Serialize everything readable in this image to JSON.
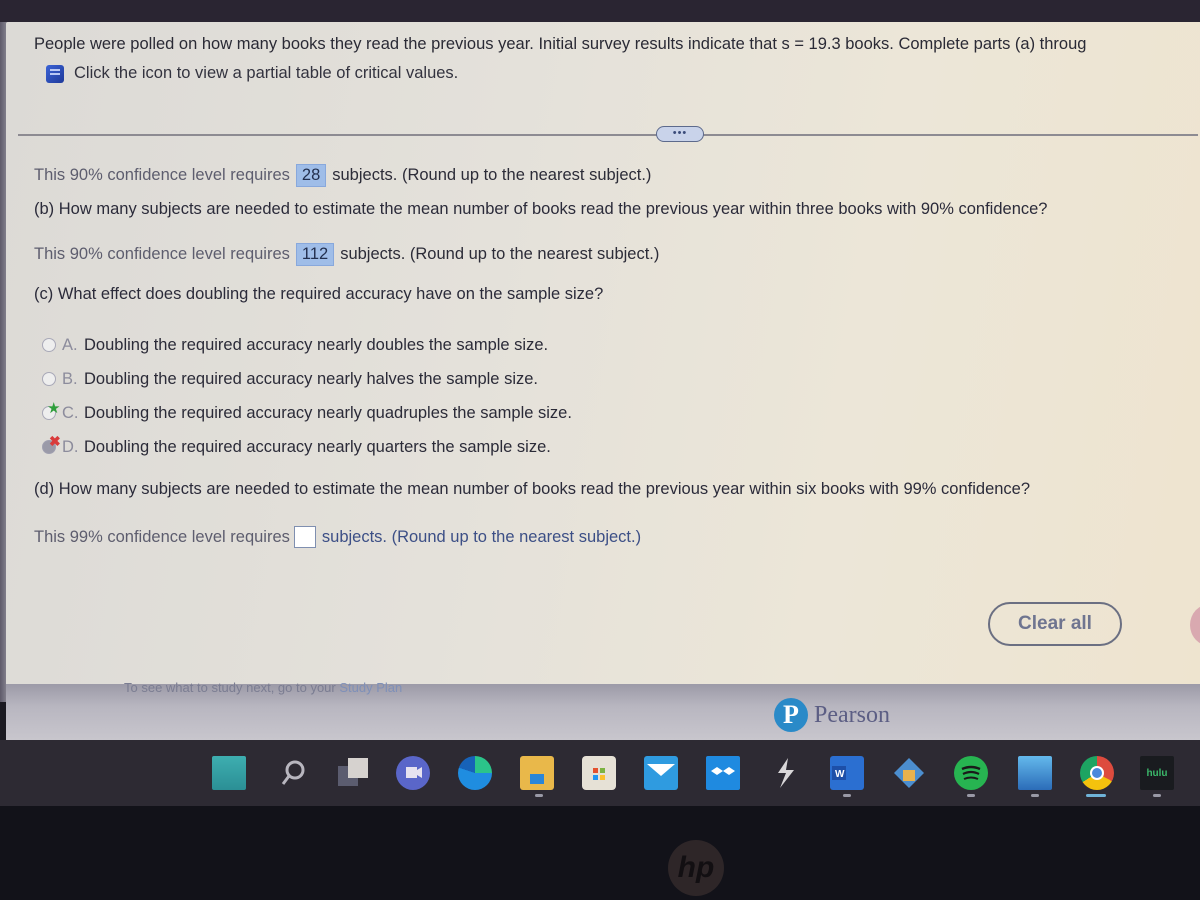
{
  "question": {
    "header_text": "People were polled on how many books they read the previous year. Initial survey results indicate that s = 19.3 books. Complete parts (a) throug",
    "table_link_text": "Click the icon to view a partial table of critical values.",
    "more_button_label": "•••"
  },
  "part_a": {
    "result_prefix": "This 90% confidence level requires",
    "answer": "28",
    "result_suffix": "subjects. (Round up to the nearest subject.)"
  },
  "part_b": {
    "question": "(b) How many subjects are needed to estimate the mean number of books read the previous year within three books with 90% confidence?",
    "result_prefix": "This 90% confidence level requires",
    "answer": "112",
    "result_suffix": "subjects. (Round up to the nearest subject.)"
  },
  "part_c": {
    "question": "(c) What effect does doubling the required accuracy have on the sample size?",
    "options": [
      {
        "letter": "A.",
        "text": "Doubling the required accuracy nearly doubles the sample size.",
        "state": "unselected"
      },
      {
        "letter": "B.",
        "text": "Doubling the required accuracy nearly halves the sample size.",
        "state": "unselected"
      },
      {
        "letter": "C.",
        "text": "Doubling the required accuracy nearly quadruples the sample size.",
        "state": "correct-answer",
        "mark": "★"
      },
      {
        "letter": "D.",
        "text": "Doubling the required accuracy nearly quarters the sample size.",
        "state": "selected-incorrect",
        "mark": "✖"
      }
    ]
  },
  "part_d": {
    "question": "(d) How many subjects are needed to estimate the mean number of books read the previous year within six books with 99% confidence?",
    "result_prefix": "This 99% confidence level requires",
    "answer": "",
    "result_suffix": "subjects. (Round up to the nearest subject.)"
  },
  "actions": {
    "clear_all_label": "Clear all"
  },
  "footer": {
    "study_text": "To see what to study next, go to your",
    "study_link": "Study Plan",
    "brand_logo": "P",
    "brand_name": "Pearson"
  },
  "taskbar": {
    "apps": [
      "start",
      "search",
      "task-view",
      "teams-chat",
      "edge",
      "file-explorer",
      "microsoft-store",
      "mail",
      "dropbox",
      "winamp",
      "word",
      "vpn",
      "spotify",
      "photos",
      "chrome",
      "hulu"
    ],
    "hulu_label": "hulu"
  },
  "laptop": {
    "brand": "hp"
  },
  "colors": {
    "answer_highlight": "#9fbde8",
    "correct_star": "#2f9e3b",
    "incorrect_x": "#d93b3b",
    "pearson_blue": "#2a8ac8"
  }
}
